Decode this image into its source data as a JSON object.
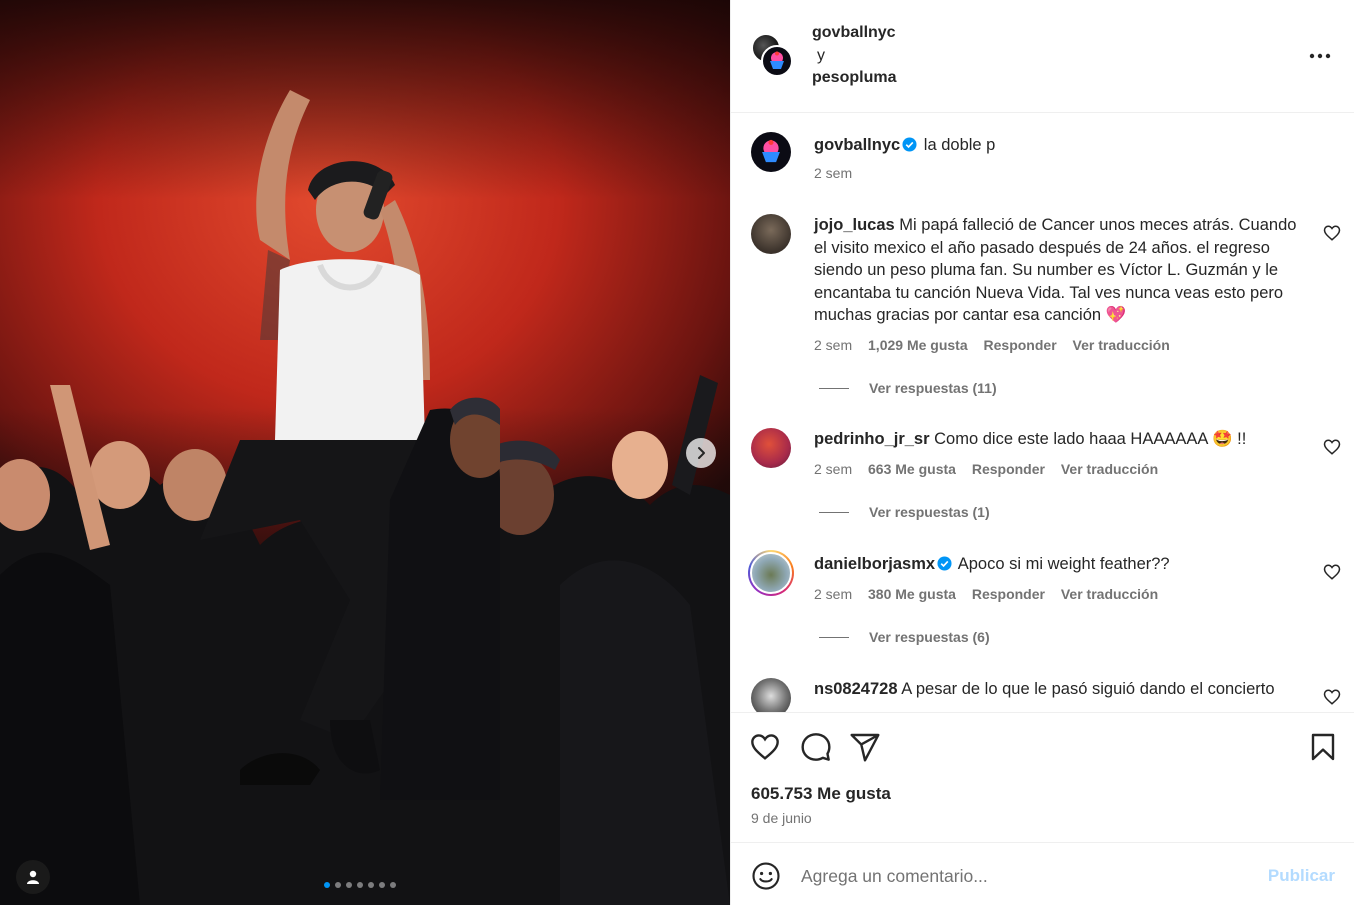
{
  "header": {
    "account_primary": "govballnyc",
    "joiner": "y",
    "account_secondary": "pesopluma",
    "more_icon": "more-horizontal-icon"
  },
  "caption": {
    "username": "govballnyc",
    "text": "la doble p",
    "time": "2 sem"
  },
  "comments": [
    {
      "username": "jojo_lucas",
      "text": "Mi papá falleció de Cancer unos meces atrás. Cuando el visito mexico el año pasado después de 24 años. el regreso siendo un peso pluma fan. Su number es Víctor L. Guzmán y le encantaba tu canción Nueva Vida. Tal ves nunca veas esto pero muchas gracias por cantar esa canción 💖",
      "time": "2 sem",
      "likes": "1,029 Me gusta",
      "reply": "Responder",
      "translate": "Ver traducción",
      "view_replies": "Ver respuestas (11)"
    },
    {
      "username": "pedrinho_jr_sr",
      "text": "Como dice este lado haaa HAAAAAA 🤩 !!",
      "time": "2 sem",
      "likes": "663 Me gusta",
      "reply": "Responder",
      "translate": "Ver traducción",
      "view_replies": "Ver respuestas (1)"
    },
    {
      "username": "danielborjasmx",
      "text": "Apoco si mi weight feather??",
      "time": "2 sem",
      "likes": "380 Me gusta",
      "reply": "Responder",
      "translate": "Ver traducción",
      "view_replies": "Ver respuestas (6)"
    },
    {
      "username": "ns0824728",
      "text": "A pesar de lo que le pasó siguió dando el concierto"
    }
  ],
  "actions": {
    "like_icon": "heart-icon",
    "comment_icon": "comment-icon",
    "share_icon": "send-icon",
    "save_icon": "bookmark-icon"
  },
  "stats": {
    "likes": "605.753 Me gusta",
    "date": "9 de junio"
  },
  "composer": {
    "placeholder": "Agrega un comentario...",
    "publish_label": "Publicar"
  },
  "carousel": {
    "total": 7,
    "current": 1
  },
  "colors": {
    "verified": "#0095f6",
    "publish_disabled": "#b3dbff",
    "secondary_text": "#737373"
  }
}
